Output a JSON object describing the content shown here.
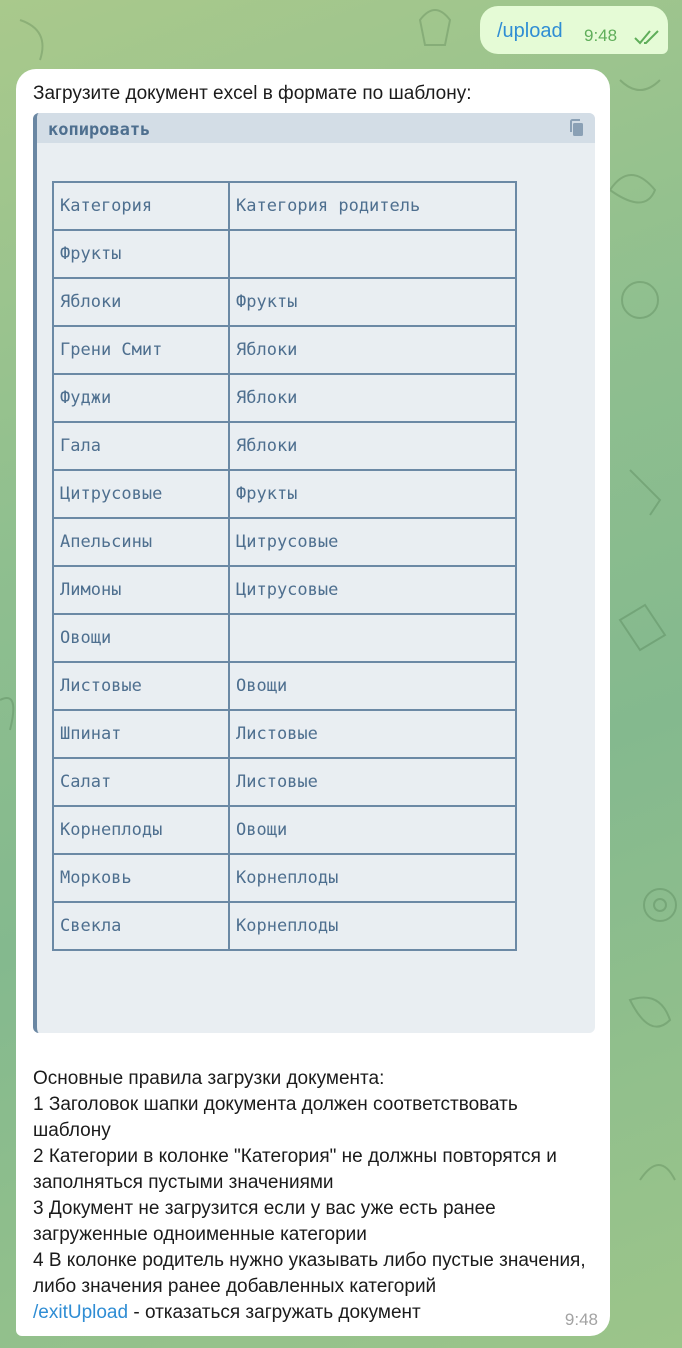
{
  "outgoing": {
    "command": "/upload",
    "time": "9:48",
    "status_icon": "double-check-icon"
  },
  "incoming": {
    "intro": "Загрузите документ excel в формате по шаблону:",
    "code": {
      "lang_label": "копировать",
      "copy_icon": "copy-icon",
      "rows": [
        [
          "Категория",
          "Категория родитель"
        ],
        [
          "Фрукты",
          ""
        ],
        [
          "Яблоки",
          "Фрукты"
        ],
        [
          "Грени Смит",
          "Яблоки"
        ],
        [
          "Фуджи",
          "Яблоки"
        ],
        [
          "Гала",
          "Яблоки"
        ],
        [
          "Цитрусовые",
          "Фрукты"
        ],
        [
          "Апельсины",
          "Цитрусовые"
        ],
        [
          "Лимоны",
          "Цитрусовые"
        ],
        [
          "Овощи",
          ""
        ],
        [
          "Листовые",
          "Овощи"
        ],
        [
          "Шпинат",
          "Листовые"
        ],
        [
          "Салат",
          "Листовые"
        ],
        [
          "Корнеплоды",
          "Овощи"
        ],
        [
          "Морковь",
          "Корнеплоды"
        ],
        [
          "Свекла",
          "Корнеплоды"
        ]
      ]
    },
    "rules_title": "Основные правила загрузки документа:",
    "rules": [
      "1 Заголовок шапки документа должен соответствовать шаблону",
      "2 Категории в колонке \"Категория\" не должны повторятся и заполняться пустыми значениями",
      "3 Документ не загрузится если у вас уже есть ранее загруженные одноименные категории",
      "4 В колонке родитель нужно указывать либо пустые значения, либо значения ранее добавленных категорий"
    ],
    "exit_command": "/exitUpload",
    "exit_text": " - отказаться загружать документ",
    "time": "9:48"
  },
  "colors": {
    "outgoing_bubble": "#e5fbd6",
    "link": "#2f8dd4",
    "code_text": "#4e6f8f",
    "background": "#8fbf8f"
  }
}
